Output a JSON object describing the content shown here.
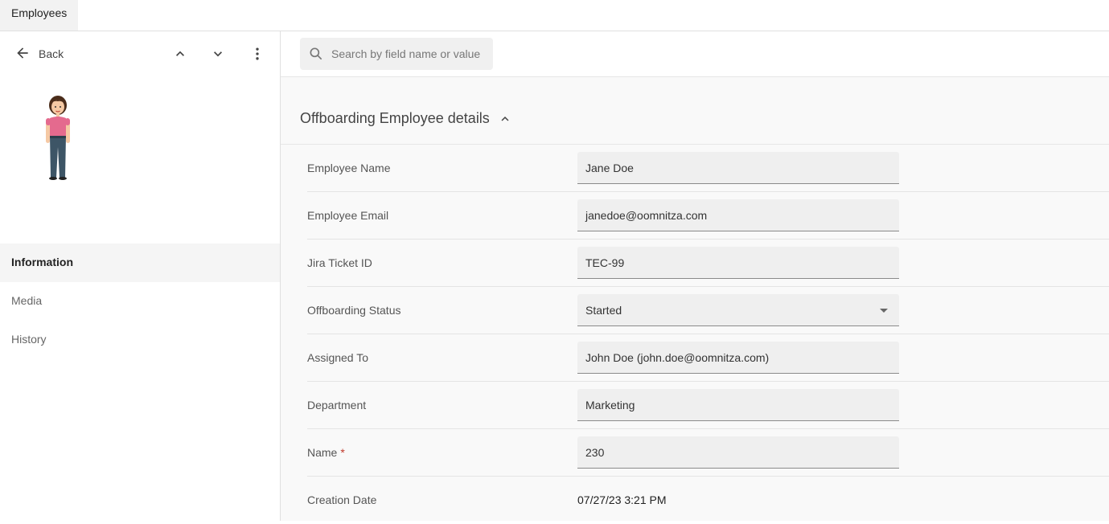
{
  "tabs": [
    {
      "label": "Employees"
    }
  ],
  "left": {
    "back_label": "Back",
    "icons": {
      "back": "arrow-left-icon",
      "prev": "chevron-up-icon",
      "next": "chevron-down-icon",
      "more": "more-vertical-icon"
    },
    "nav": [
      {
        "label": "Information",
        "active": true
      },
      {
        "label": "Media",
        "active": false
      },
      {
        "label": "History",
        "active": false
      }
    ]
  },
  "search": {
    "placeholder": "Search by field name or value"
  },
  "section": {
    "title": "Offboarding Employee details",
    "expanded": true
  },
  "fields": {
    "employee_name": {
      "label": "Employee Name",
      "value": "Jane Doe"
    },
    "employee_email": {
      "label": "Employee Email",
      "value": "janedoe@oomnitza.com"
    },
    "jira_ticket": {
      "label": "Jira Ticket ID",
      "value": "TEC-99"
    },
    "offboarding_status": {
      "label": "Offboarding Status",
      "value": "Started"
    },
    "assigned_to": {
      "label": "Assigned To",
      "value": "John Doe (john.doe@oomnitza.com)"
    },
    "department": {
      "label": "Department",
      "value": "Marketing"
    },
    "name": {
      "label": "Name",
      "required_mark": "*",
      "value": "230"
    },
    "creation_date": {
      "label": "Creation Date",
      "value": "07/27/23 3:21 PM"
    }
  },
  "colors": {
    "accent": "#333333",
    "required": "#c0392b",
    "field_bg": "#efefef"
  }
}
